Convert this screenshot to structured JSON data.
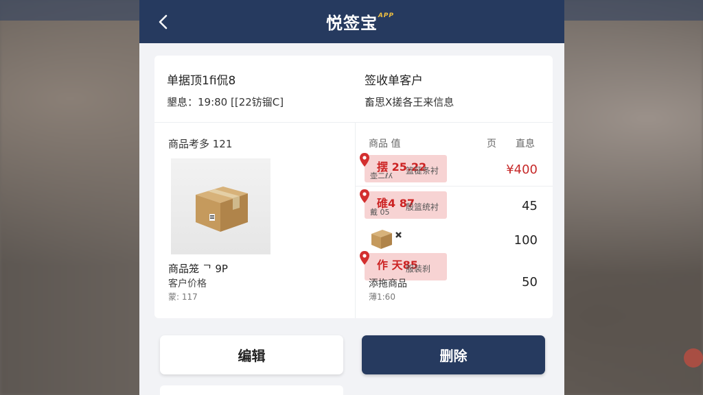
{
  "app": {
    "title": "悦签宝",
    "badge": "APP"
  },
  "document": {
    "title": "单据顶1fi侃8",
    "subtitle": "墾息：19:80 [[22钫镏C]"
  },
  "customer": {
    "title": "签收单客户",
    "subtitle": "畜思X搓各王来信息"
  },
  "product": {
    "header": "商品考多 121",
    "name": "商品笼 ᄀ 9P",
    "price_label": "客户价格",
    "extra": "蒙: 117",
    "image_icon": "cardboard-box-icon"
  },
  "list": {
    "headers": [
      "商品 值",
      "页",
      "直息"
    ],
    "tags": [
      {
        "main": "摆 25.22",
        "sub": "壶二ℓʎ",
        "right": "篮蓰条衬"
      },
      {
        "main": "碓4 87",
        "sub": "戴 05",
        "right": "殷篮统衬"
      },
      {
        "main": "作 天85",
        "sub": "",
        "right": "服装刹"
      }
    ],
    "values": [
      "¥400",
      "45",
      "100",
      "50"
    ],
    "mini_item_icon": "package-icon",
    "mini_label": "添拖商品",
    "mini_extra": "薄1:60"
  },
  "actions": {
    "edit": "编辑",
    "delete": "删除"
  },
  "colors": {
    "primary": "#263a5f",
    "accent_red": "#c62828",
    "badge": "#f0c040"
  }
}
